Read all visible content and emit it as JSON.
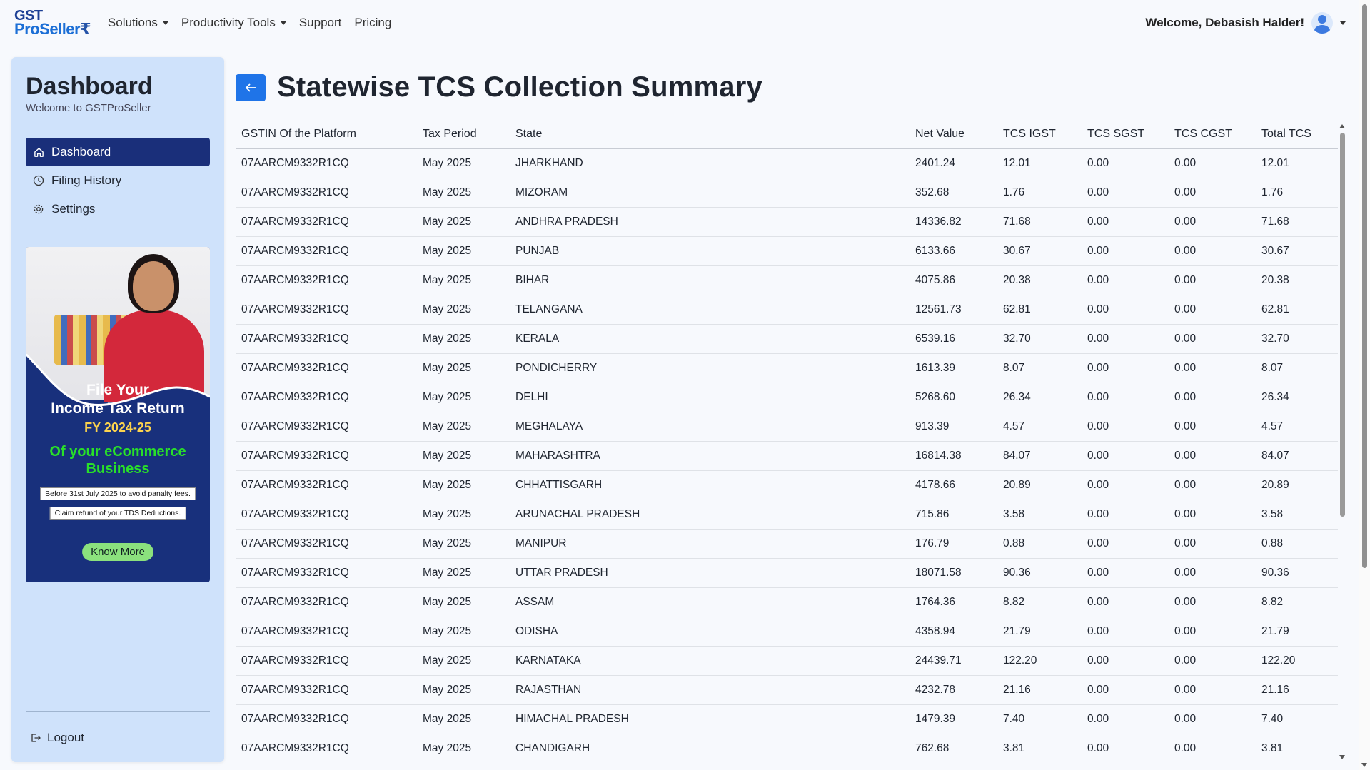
{
  "brand": {
    "line1": "GST",
    "line2": "ProSeller",
    "rupee": "₹"
  },
  "nav": {
    "items": [
      {
        "label": "Solutions",
        "dropdown": true
      },
      {
        "label": "Productivity Tools",
        "dropdown": true
      },
      {
        "label": "Support",
        "dropdown": false
      },
      {
        "label": "Pricing",
        "dropdown": false
      }
    ],
    "welcome": "Welcome, Debasish Halder!"
  },
  "sidebar": {
    "title": "Dashboard",
    "subtitle": "Welcome to GSTProSeller",
    "items": [
      {
        "label": "Dashboard",
        "icon": "home-icon",
        "active": true
      },
      {
        "label": "Filing History",
        "icon": "clock-icon",
        "active": false
      },
      {
        "label": "Settings",
        "icon": "gear-icon",
        "active": false
      }
    ],
    "promo": {
      "line1": "File Your",
      "line2": "Income Tax Return",
      "fy": "FY 2024-25",
      "highlight1": "Of your eCommerce",
      "highlight2": "Business",
      "note1": "Before 31st July 2025 to avoid panalty fees.",
      "note2": "Claim refund of your TDS Deductions.",
      "cta": "Know More"
    },
    "logout": "Logout"
  },
  "page": {
    "title": "Statewise TCS Collection Summary",
    "back_icon": "arrow-left-icon"
  },
  "table": {
    "headers": [
      "GSTIN Of the Platform",
      "Tax Period",
      "State",
      "Net Value",
      "TCS IGST",
      "TCS SGST",
      "TCS CGST",
      "Total TCS"
    ],
    "rows": [
      [
        "07AARCM9332R1CQ",
        "May 2025",
        "JHARKHAND",
        "2401.24",
        "12.01",
        "0.00",
        "0.00",
        "12.01"
      ],
      [
        "07AARCM9332R1CQ",
        "May 2025",
        "MIZORAM",
        "352.68",
        "1.76",
        "0.00",
        "0.00",
        "1.76"
      ],
      [
        "07AARCM9332R1CQ",
        "May 2025",
        "ANDHRA PRADESH",
        "14336.82",
        "71.68",
        "0.00",
        "0.00",
        "71.68"
      ],
      [
        "07AARCM9332R1CQ",
        "May 2025",
        "PUNJAB",
        "6133.66",
        "30.67",
        "0.00",
        "0.00",
        "30.67"
      ],
      [
        "07AARCM9332R1CQ",
        "May 2025",
        "BIHAR",
        "4075.86",
        "20.38",
        "0.00",
        "0.00",
        "20.38"
      ],
      [
        "07AARCM9332R1CQ",
        "May 2025",
        "TELANGANA",
        "12561.73",
        "62.81",
        "0.00",
        "0.00",
        "62.81"
      ],
      [
        "07AARCM9332R1CQ",
        "May 2025",
        "KERALA",
        "6539.16",
        "32.70",
        "0.00",
        "0.00",
        "32.70"
      ],
      [
        "07AARCM9332R1CQ",
        "May 2025",
        "PONDICHERRY",
        "1613.39",
        "8.07",
        "0.00",
        "0.00",
        "8.07"
      ],
      [
        "07AARCM9332R1CQ",
        "May 2025",
        "DELHI",
        "5268.60",
        "26.34",
        "0.00",
        "0.00",
        "26.34"
      ],
      [
        "07AARCM9332R1CQ",
        "May 2025",
        "MEGHALAYA",
        "913.39",
        "4.57",
        "0.00",
        "0.00",
        "4.57"
      ],
      [
        "07AARCM9332R1CQ",
        "May 2025",
        "MAHARASHTRA",
        "16814.38",
        "84.07",
        "0.00",
        "0.00",
        "84.07"
      ],
      [
        "07AARCM9332R1CQ",
        "May 2025",
        "CHHATTISGARH",
        "4178.66",
        "20.89",
        "0.00",
        "0.00",
        "20.89"
      ],
      [
        "07AARCM9332R1CQ",
        "May 2025",
        "ARUNACHAL PRADESH",
        "715.86",
        "3.58",
        "0.00",
        "0.00",
        "3.58"
      ],
      [
        "07AARCM9332R1CQ",
        "May 2025",
        "MANIPUR",
        "176.79",
        "0.88",
        "0.00",
        "0.00",
        "0.88"
      ],
      [
        "07AARCM9332R1CQ",
        "May 2025",
        "UTTAR PRADESH",
        "18071.58",
        "90.36",
        "0.00",
        "0.00",
        "90.36"
      ],
      [
        "07AARCM9332R1CQ",
        "May 2025",
        "ASSAM",
        "1764.36",
        "8.82",
        "0.00",
        "0.00",
        "8.82"
      ],
      [
        "07AARCM9332R1CQ",
        "May 2025",
        "ODISHA",
        "4358.94",
        "21.79",
        "0.00",
        "0.00",
        "21.79"
      ],
      [
        "07AARCM9332R1CQ",
        "May 2025",
        "KARNATAKA",
        "24439.71",
        "122.20",
        "0.00",
        "0.00",
        "122.20"
      ],
      [
        "07AARCM9332R1CQ",
        "May 2025",
        "RAJASTHAN",
        "4232.78",
        "21.16",
        "0.00",
        "0.00",
        "21.16"
      ],
      [
        "07AARCM9332R1CQ",
        "May 2025",
        "HIMACHAL PRADESH",
        "1479.39",
        "7.40",
        "0.00",
        "0.00",
        "7.40"
      ],
      [
        "07AARCM9332R1CQ",
        "May 2025",
        "CHANDIGARH",
        "762.68",
        "3.81",
        "0.00",
        "0.00",
        "3.81"
      ]
    ]
  },
  "colors": {
    "primary": "#1f74e8",
    "sidebar_bg": "#cfe2fb",
    "active_item": "#1a2f7a",
    "promo_bg": "#18307c",
    "promo_highlight": "#29e029"
  }
}
